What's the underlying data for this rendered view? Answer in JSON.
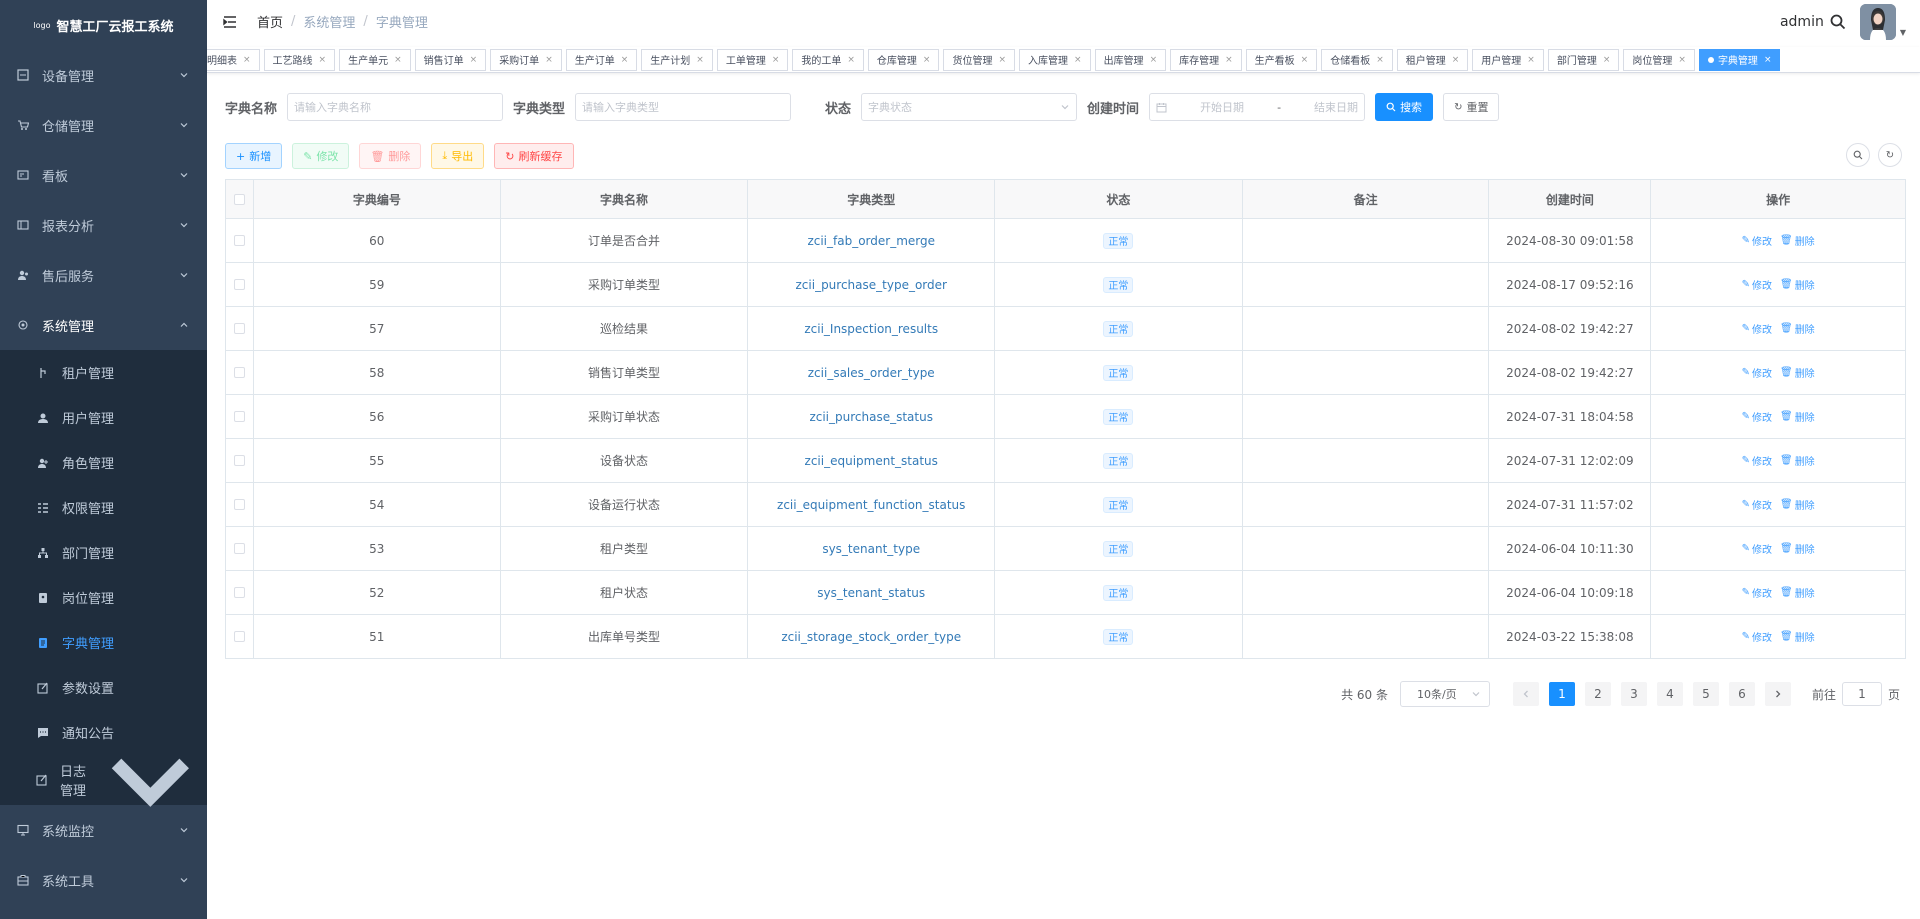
{
  "app": {
    "logo_text": "logo",
    "title": "智慧工厂云报工系统"
  },
  "sidebar": {
    "items": [
      {
        "label": "设备管理",
        "icon": "equipment-icon"
      },
      {
        "label": "仓储管理",
        "icon": "cart-icon"
      },
      {
        "label": "看板",
        "icon": "dashboard-icon"
      },
      {
        "label": "报表分析",
        "icon": "report-icon"
      },
      {
        "label": "售后服务",
        "icon": "service-icon"
      },
      {
        "label": "系统管理",
        "icon": "system-icon"
      }
    ],
    "system_children": [
      {
        "label": "租户管理",
        "icon": "tenant-icon"
      },
      {
        "label": "用户管理",
        "icon": "user-icon"
      },
      {
        "label": "角色管理",
        "icon": "role-icon"
      },
      {
        "label": "权限管理",
        "icon": "permission-icon"
      },
      {
        "label": "部门管理",
        "icon": "department-icon"
      },
      {
        "label": "岗位管理",
        "icon": "post-icon"
      },
      {
        "label": "字典管理",
        "icon": "dictionary-icon",
        "active": true
      },
      {
        "label": "参数设置",
        "icon": "param-icon"
      },
      {
        "label": "通知公告",
        "icon": "notice-icon"
      },
      {
        "label": "日志管理",
        "icon": "log-icon"
      }
    ],
    "bottom_items": [
      {
        "label": "系统监控",
        "icon": "monitor-icon"
      },
      {
        "label": "系统工具",
        "icon": "tools-icon"
      }
    ]
  },
  "header": {
    "breadcrumb": [
      "首页",
      "系统管理",
      "字典管理"
    ],
    "username": "admin"
  },
  "tags": [
    "明细表",
    "工艺路线",
    "生产单元",
    "销售订单",
    "采购订单",
    "生产订单",
    "生产计划",
    "工单管理",
    "我的工单",
    "仓库管理",
    "货位管理",
    "入库管理",
    "出库管理",
    "库存管理",
    "生产看板",
    "仓储看板",
    "租户管理",
    "用户管理",
    "部门管理",
    "岗位管理",
    "字典管理"
  ],
  "search": {
    "dict_name_label": "字典名称",
    "dict_name_placeholder": "请输入字典名称",
    "dict_type_label": "字典类型",
    "dict_type_placeholder": "请输入字典类型",
    "status_label": "状态",
    "status_placeholder": "字典状态",
    "created_label": "创建时间",
    "start_placeholder": "开始日期",
    "range_sep": "-",
    "end_placeholder": "结束日期",
    "search_btn": "搜索",
    "reset_btn": "重置"
  },
  "toolbar": {
    "add": "新增",
    "edit": "修改",
    "delete": "删除",
    "export": "导出",
    "refresh_cache": "刷新缓存"
  },
  "table": {
    "headers": [
      "字典编号",
      "字典名称",
      "字典类型",
      "状态",
      "备注",
      "创建时间",
      "操作"
    ],
    "edit_label": "修改",
    "delete_label": "删除",
    "rows": [
      {
        "id": "60",
        "name": "订单是否合并",
        "type": "zcii_fab_order_merge",
        "status": "正常",
        "remark": "",
        "created": "2024-08-30 09:01:58"
      },
      {
        "id": "59",
        "name": "采购订单类型",
        "type": "zcii_purchase_type_order",
        "status": "正常",
        "remark": "",
        "created": "2024-08-17 09:52:16"
      },
      {
        "id": "57",
        "name": "巡检结果",
        "type": "zcii_Inspection_results",
        "status": "正常",
        "remark": "",
        "created": "2024-08-02 19:42:27"
      },
      {
        "id": "58",
        "name": "销售订单类型",
        "type": "zcii_sales_order_type",
        "status": "正常",
        "remark": "",
        "created": "2024-08-02 19:42:27"
      },
      {
        "id": "56",
        "name": "采购订单状态",
        "type": "zcii_purchase_status",
        "status": "正常",
        "remark": "",
        "created": "2024-07-31 18:04:58"
      },
      {
        "id": "55",
        "name": "设备状态",
        "type": "zcii_equipment_status",
        "status": "正常",
        "remark": "",
        "created": "2024-07-31 12:02:09"
      },
      {
        "id": "54",
        "name": "设备运行状态",
        "type": "zcii_equipment_function_status",
        "status": "正常",
        "remark": "",
        "created": "2024-07-31 11:57:02"
      },
      {
        "id": "53",
        "name": "租户类型",
        "type": "sys_tenant_type",
        "status": "正常",
        "remark": "",
        "created": "2024-06-04 10:11:30"
      },
      {
        "id": "52",
        "name": "租户状态",
        "type": "sys_tenant_status",
        "status": "正常",
        "remark": "",
        "created": "2024-06-04 10:09:18"
      },
      {
        "id": "51",
        "name": "出库单号类型",
        "type": "zcii_storage_stock_order_type",
        "status": "正常",
        "remark": "",
        "created": "2024-03-22 15:38:08"
      }
    ]
  },
  "pagination": {
    "total": "共 60 条",
    "page_size": "10条/页",
    "pages": [
      "1",
      "2",
      "3",
      "4",
      "5",
      "6"
    ],
    "current": "1",
    "goto_label": "前往",
    "goto_value": "1",
    "page_suffix": "页"
  },
  "colors": {
    "sidebar_bg": "#304156",
    "submenu_bg": "#1f2d3d",
    "primary": "#1890ff",
    "active_menu": "#409eff"
  }
}
